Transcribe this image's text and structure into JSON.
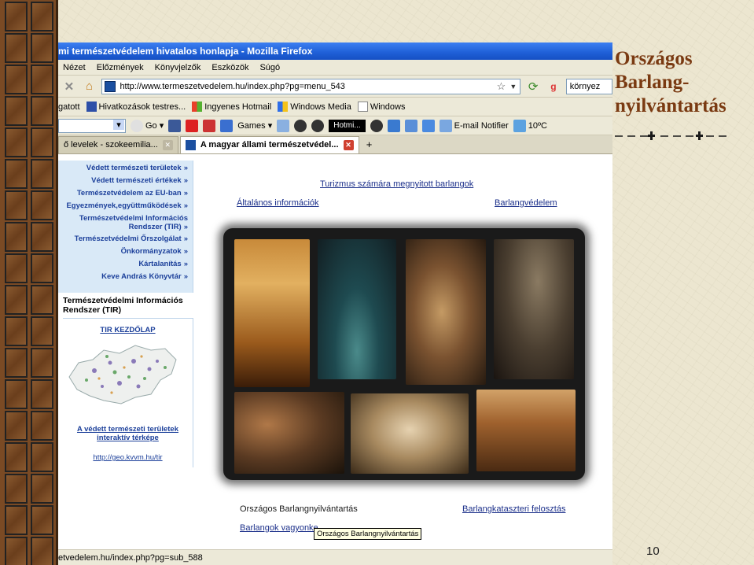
{
  "slide": {
    "title_lines": [
      "Országos",
      "Barlang-",
      "nyilvántartás"
    ],
    "page_number": "10"
  },
  "browser": {
    "window_title": "mi természetvédelem hivatalos honlapja - Mozilla Firefox",
    "menu": [
      "Nézet",
      "Előzmények",
      "Könyvjelzők",
      "Eszközök",
      "Súgó"
    ],
    "url": "http://www.termeszetvedelem.hu/index.php?pg=menu_543",
    "search_text": "környez",
    "bookmarks": [
      "gatott",
      "Hivatkozások testres...",
      "Ingyenes Hotmail",
      "Windows Media",
      "Windows"
    ],
    "toolbar2": {
      "go_label": "Go",
      "games_label": "Games",
      "hotmail_label": "Hotmi...",
      "email_label": "E-mail Notifier",
      "temperature": "10ºC"
    },
    "tabs": [
      {
        "label": "ő levelek - szokeemilia...",
        "active": false
      },
      {
        "label": "A magyar állami természetvédel...",
        "active": true
      }
    ],
    "tab_add": "+",
    "status_text": "etvedelem.hu/index.php?pg=sub_588"
  },
  "page": {
    "sidebar_menu": [
      "Védett természeti területek",
      "Védett természeti értékek",
      "Természetvédelem az EU-ban",
      "Egyezmények,együttműködések",
      "Természetvédelmi Információs|Rendszer (TIR)",
      "Természetvédelmi Őrszolgálat",
      "Önkormányzatok",
      "Kártalanítás",
      "Keve András Könyvtár"
    ],
    "tir": {
      "title_line1": "Természetvédelmi Információs",
      "title_line2": "Rendszer (TIR)",
      "home_link": "TIR KEZDŐLAP",
      "map_link_line1": "A védett természeti területek",
      "map_link_line2": "interaktív térképe",
      "url_link": "http://geo.kvvm.hu/tir"
    },
    "links": {
      "tourism": "Turizmus számára megnyitott barlangok",
      "general": "Általános információk",
      "protection": "Barlangvédelem",
      "registry": "Országos Barlangnyilvántartás",
      "cadastre": "Barlangkataszteri felosztás",
      "assets": "Barlangok vagyonke"
    },
    "tooltip": "Országos Barlangnyilvántartás"
  },
  "colors": {
    "title_brown": "#7a3a12",
    "link_blue": "#1b2f8a",
    "sidebar_bg": "#d9e9f7"
  }
}
